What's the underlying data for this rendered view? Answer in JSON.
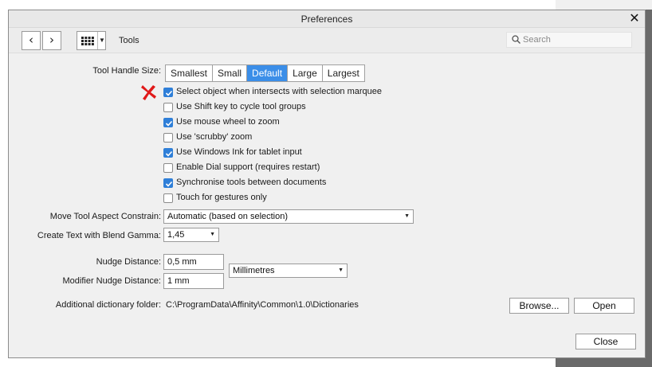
{
  "window": {
    "title": "Preferences",
    "close_icon": "close-icon"
  },
  "toolbar": {
    "back_icon": "chevron-left-icon",
    "forward_icon": "chevron-right-icon",
    "grid_icon": "grid-icon",
    "section": "Tools",
    "search_placeholder": "Search",
    "search_value": ""
  },
  "tool_handle": {
    "label": "Tool Handle Size:",
    "options": [
      "Smallest",
      "Small",
      "Default",
      "Large",
      "Largest"
    ],
    "selected": "Default"
  },
  "annotation": {
    "icon": "red-x-marker-icon",
    "color": "#e01919"
  },
  "checkboxes": [
    {
      "label": "Select object when intersects with selection marquee",
      "checked": true
    },
    {
      "label": "Use Shift key to cycle tool groups",
      "checked": false
    },
    {
      "label": "Use mouse wheel to zoom",
      "checked": true
    },
    {
      "label": "Use 'scrubby' zoom",
      "checked": false
    },
    {
      "label": "Use Windows Ink for tablet input",
      "checked": true
    },
    {
      "label": "Enable Dial support (requires restart)",
      "checked": false
    },
    {
      "label": "Synchronise tools between documents",
      "checked": true
    },
    {
      "label": "Touch for gestures only",
      "checked": false
    }
  ],
  "move_tool": {
    "label": "Move Tool Aspect Constrain:",
    "value": "Automatic (based on selection)"
  },
  "blend_gamma": {
    "label": "Create Text with Blend Gamma:",
    "value": "1,45"
  },
  "nudge": {
    "label": "Nudge Distance:",
    "value": "0,5 mm"
  },
  "modifier_nudge": {
    "label": "Modifier Nudge Distance:",
    "value": "1 mm"
  },
  "units": {
    "value": "Millimetres"
  },
  "dictionary": {
    "label": "Additional dictionary folder:",
    "path": "C:\\ProgramData\\Affinity\\Common\\1.0\\Dictionaries",
    "browse_label": "Browse...",
    "open_label": "Open"
  },
  "footer": {
    "close_label": "Close"
  },
  "colors": {
    "accent": "#3b8ee8",
    "checkbox": "#2f7fd8",
    "dialog_bg": "#f0f0f0"
  }
}
